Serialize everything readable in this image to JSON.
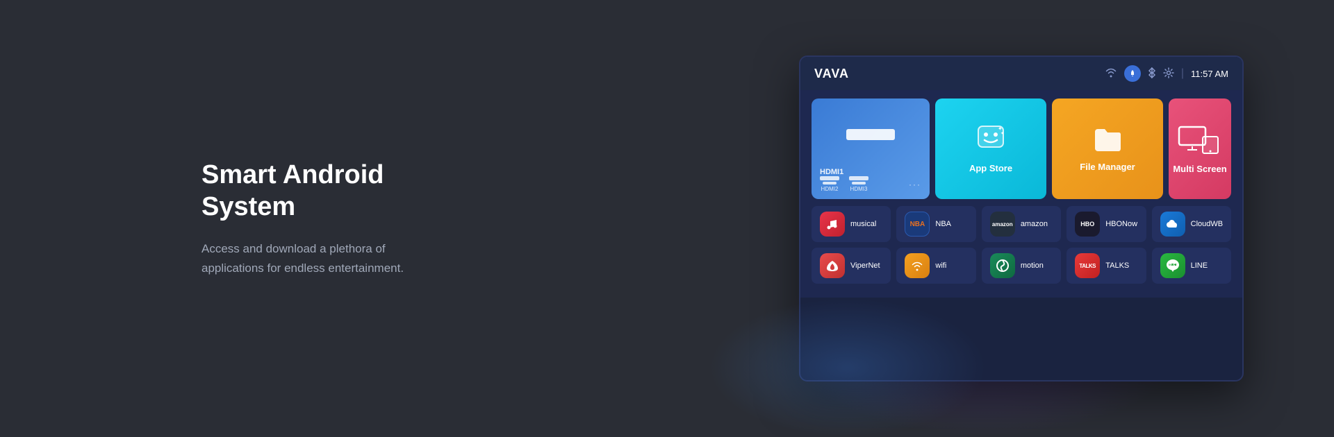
{
  "page": {
    "background_color": "#2a2d35"
  },
  "left": {
    "title": "Smart Android System",
    "description": "Access and download a plethora of\napplications for endless entertainment."
  },
  "tv": {
    "logo": "VAVA",
    "time": "11:57 AM",
    "top_tiles": [
      {
        "id": "hdmi",
        "label": "HDMI1",
        "sub_items": [
          "HDMI2",
          "HDMI3"
        ]
      },
      {
        "id": "app_store",
        "label": "App Store"
      },
      {
        "id": "file_manager",
        "label": "File Manager"
      },
      {
        "id": "multi_screen",
        "label": "Multi Screen"
      }
    ],
    "app_rows": [
      [
        {
          "id": "musical",
          "name": "musical"
        },
        {
          "id": "nba",
          "name": "NBA"
        },
        {
          "id": "amazon",
          "name": "amazon"
        },
        {
          "id": "hbonow",
          "name": "HBONow"
        },
        {
          "id": "cloudwb",
          "name": "CloudWB"
        }
      ],
      [
        {
          "id": "vipernet",
          "name": "ViperNet"
        },
        {
          "id": "wifi",
          "name": "wifi"
        },
        {
          "id": "motion",
          "name": "motion"
        },
        {
          "id": "talks",
          "name": "TALKS"
        },
        {
          "id": "line",
          "name": "LINE"
        }
      ]
    ]
  }
}
